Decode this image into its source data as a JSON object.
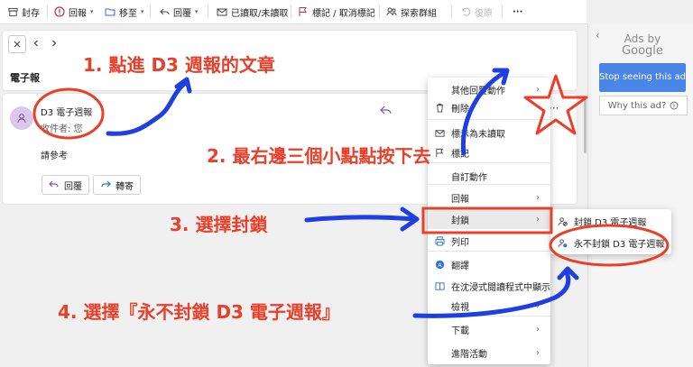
{
  "toolbar": {
    "archive": "封存",
    "report": "回報",
    "move_to": "移至",
    "reply": "回覆",
    "read_unread": "已讀取/未讀取",
    "flag": "標記 / 取消標記",
    "browse_groups": "探索群組",
    "undo": "復原",
    "more": "···"
  },
  "reading": {
    "subject": "電子報",
    "sender": "D3 電子週報",
    "recipient": "收件者: 您",
    "body": "請參考",
    "reply_button": "回覆",
    "forward_button": "轉寄"
  },
  "menu": {
    "items": [
      {
        "label": "其他回覆動作",
        "chevron": true
      },
      {
        "label": "刪除",
        "chevron": false
      },
      {
        "label": "標示為未讀取",
        "chevron": false
      },
      {
        "label": "標記",
        "chevron": false
      },
      {
        "label": "自訂動作",
        "chevron": false
      },
      {
        "label": "回報",
        "chevron": true
      },
      {
        "label": "封鎖",
        "chevron": true
      },
      {
        "label": "列印",
        "chevron": false
      },
      {
        "label": "翻譯",
        "chevron": false
      },
      {
        "label": "在沈浸式閱讀程式中顯示",
        "chevron": false
      },
      {
        "label": "檢視",
        "chevron": true
      },
      {
        "label": "下載",
        "chevron": true
      },
      {
        "label": "進階活動",
        "chevron": true
      }
    ]
  },
  "submenu": {
    "block_sender": "封鎖 D3 電子週報",
    "never_block": "永不封鎖 D3 電子週報"
  },
  "ads": {
    "title_line1": "Ads by",
    "title_line2": "Google",
    "stop_button": "Stop seeing this ad",
    "why": "Why this ad?"
  },
  "annotations": {
    "step1": "1. 點進 D3 週報的文章",
    "step2": "2. 最右邊三個小點點按下去",
    "step3": "3. 選擇封鎖",
    "step4": "4. 選擇『永不封鎖 D3 電子週報』"
  },
  "colors": {
    "annotation_red": "#e8402a",
    "arrow_blue": "#1f3fe0",
    "ad_blue": "#4a86e8"
  }
}
